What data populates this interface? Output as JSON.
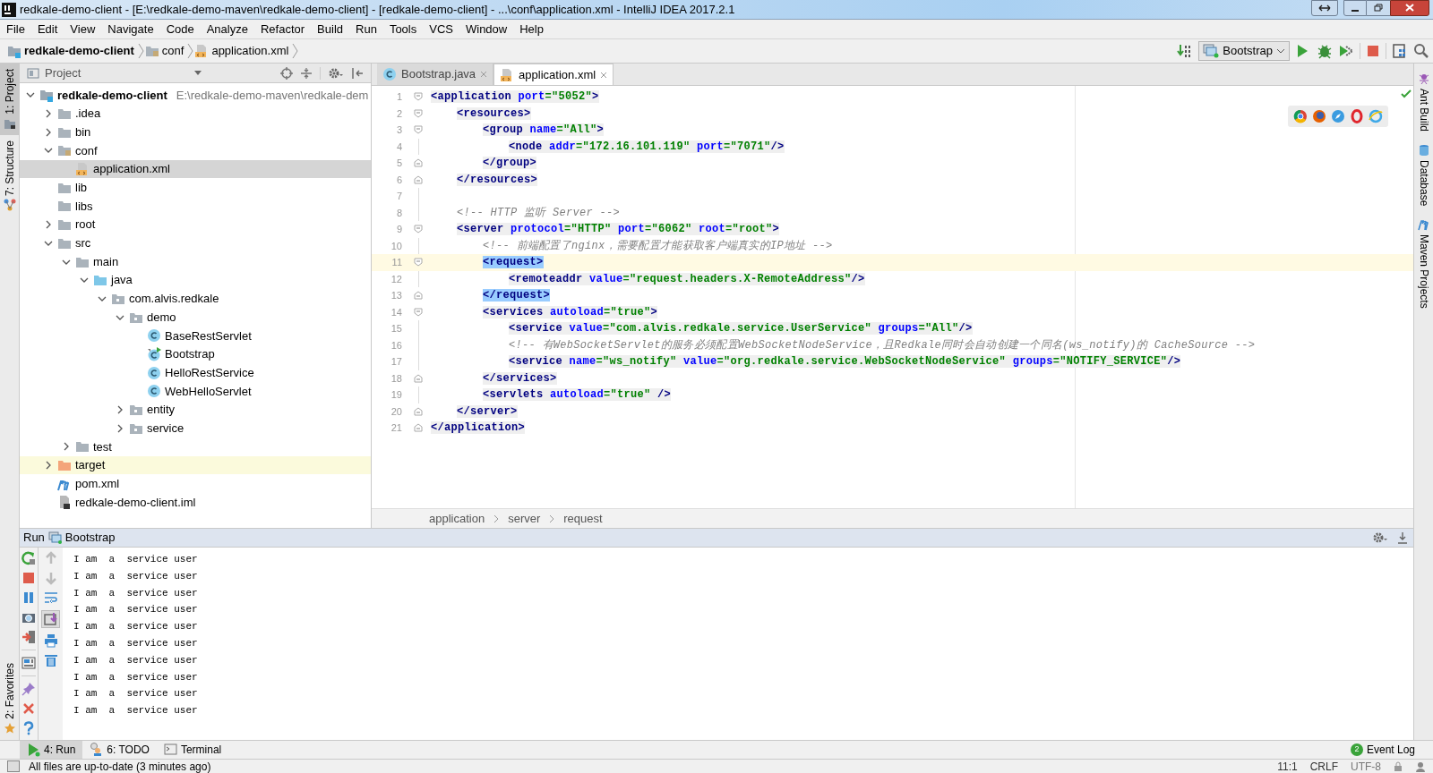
{
  "window": {
    "title": "redkale-demo-client - [E:\\redkale-demo-maven\\redkale-demo-client] - [redkale-demo-client] - ...\\conf\\application.xml - IntelliJ IDEA 2017.2.1"
  },
  "menu": [
    "File",
    "Edit",
    "View",
    "Navigate",
    "Code",
    "Analyze",
    "Refactor",
    "Build",
    "Run",
    "Tools",
    "VCS",
    "Window",
    "Help"
  ],
  "breadcrumb": [
    {
      "label": "redkale-demo-client",
      "kind": "module"
    },
    {
      "label": "conf",
      "kind": "config-folder"
    },
    {
      "label": "application.xml",
      "kind": "xml-file"
    }
  ],
  "run_config": "Bootstrap",
  "left_strip": [
    {
      "label": "1: Project",
      "selected": true
    },
    {
      "label": "7: Structure",
      "selected": false
    },
    {
      "label": "2: Favorites",
      "selected": false
    }
  ],
  "right_strip": [
    "Ant Build",
    "Database",
    "Maven Projects"
  ],
  "project_panel": {
    "title": "Project",
    "tree": [
      {
        "label": "redkale-demo-client",
        "kind": "module",
        "path": "E:\\redkale-demo-maven\\redkale-dem",
        "expanded": true,
        "selected": false,
        "children": [
          {
            "label": ".idea",
            "kind": "folder",
            "expanded": false,
            "selected": false
          },
          {
            "label": "bin",
            "kind": "folder",
            "expanded": false,
            "selected": false
          },
          {
            "label": "conf",
            "kind": "config-folder",
            "expanded": true,
            "selected": false,
            "children": [
              {
                "label": "application.xml",
                "kind": "xml-file",
                "selected": true
              }
            ]
          },
          {
            "label": "lib",
            "kind": "folder",
            "selected": false
          },
          {
            "label": "libs",
            "kind": "folder",
            "selected": false
          },
          {
            "label": "root",
            "kind": "folder",
            "expanded": false,
            "selected": false
          },
          {
            "label": "src",
            "kind": "folder",
            "expanded": true,
            "selected": false,
            "children": [
              {
                "label": "main",
                "kind": "folder",
                "expanded": true,
                "selected": false,
                "children": [
                  {
                    "label": "java",
                    "kind": "source-folder",
                    "expanded": true,
                    "selected": false,
                    "children": [
                      {
                        "label": "com.alvis.redkale",
                        "kind": "package",
                        "expanded": true,
                        "selected": false,
                        "children": [
                          {
                            "label": "demo",
                            "kind": "package",
                            "expanded": true,
                            "selected": false,
                            "children": [
                              {
                                "label": "BaseRestServlet",
                                "kind": "class",
                                "selected": false
                              },
                              {
                                "label": "Bootstrap",
                                "kind": "main-class",
                                "selected": false
                              },
                              {
                                "label": "HelloRestService",
                                "kind": "class",
                                "selected": false
                              },
                              {
                                "label": "WebHelloServlet",
                                "kind": "class",
                                "selected": false
                              }
                            ]
                          },
                          {
                            "label": "entity",
                            "kind": "package",
                            "expanded": false,
                            "selected": false
                          },
                          {
                            "label": "service",
                            "kind": "package",
                            "expanded": false,
                            "selected": false
                          }
                        ]
                      }
                    ]
                  }
                ]
              },
              {
                "label": "test",
                "kind": "folder",
                "expanded": false,
                "selected": false
              }
            ]
          },
          {
            "label": "target",
            "kind": "excluded-folder",
            "expanded": false,
            "selected": false
          },
          {
            "label": "pom.xml",
            "kind": "maven-file",
            "selected": false
          },
          {
            "label": "redkale-demo-client.iml",
            "kind": "iml-file",
            "selected": false
          }
        ]
      }
    ]
  },
  "editor": {
    "tabs": [
      {
        "label": "Bootstrap.java",
        "kind": "class",
        "selected": false
      },
      {
        "label": "application.xml",
        "kind": "xml-file",
        "selected": true
      }
    ],
    "lines": [
      {
        "number": "1",
        "kind": "opening",
        "current": false,
        "segments": [
          {
            "kind": "tag",
            "text": "<application"
          },
          {
            "kind": "attr",
            "text": " port"
          },
          {
            "kind": "value",
            "text": "=\"5052\""
          },
          {
            "kind": "tag",
            "text": ">"
          }
        ],
        "children": [
          {
            "number": "2",
            "kind": "opening",
            "current": false,
            "segments": [
              {
                "kind": "tag",
                "text": "<resources>"
              }
            ],
            "children": [
              {
                "number": "3",
                "kind": "opening",
                "current": false,
                "segments": [
                  {
                    "kind": "tag",
                    "text": "<group"
                  },
                  {
                    "kind": "attr",
                    "text": " name"
                  },
                  {
                    "kind": "value",
                    "text": "=\"All\""
                  },
                  {
                    "kind": "tag",
                    "text": ">"
                  }
                ],
                "children": [
                  {
                    "number": "4",
                    "kind": "plain",
                    "current": false,
                    "segments": [
                      {
                        "kind": "tag",
                        "text": "<node"
                      },
                      {
                        "kind": "attr",
                        "text": " addr"
                      },
                      {
                        "kind": "value",
                        "text": "=\"172.16.101.119\""
                      },
                      {
                        "kind": "attr",
                        "text": " port"
                      },
                      {
                        "kind": "value",
                        "text": "=\"7071\""
                      },
                      {
                        "kind": "tag",
                        "text": "/>"
                      }
                    ]
                  }
                ]
              },
              {
                "number": "5",
                "kind": "closing",
                "current": false,
                "segments": [
                  {
                    "kind": "tag",
                    "text": "</group>"
                  }
                ]
              }
            ]
          },
          {
            "number": "6",
            "kind": "closing",
            "current": false,
            "segments": [
              {
                "kind": "tag",
                "text": "</resources>"
              }
            ]
          },
          {
            "number": "7",
            "kind": "plain",
            "current": false
          },
          {
            "number": "8",
            "kind": "plain",
            "current": false,
            "segments": [
              {
                "kind": "comment",
                "text": "<!-- HTTP 监听 Server -->"
              }
            ]
          },
          {
            "number": "9",
            "kind": "opening",
            "current": false,
            "segments": [
              {
                "kind": "tag",
                "text": "<server"
              },
              {
                "kind": "attr",
                "text": " protocol"
              },
              {
                "kind": "value",
                "text": "=\"HTTP\""
              },
              {
                "kind": "attr",
                "text": " port"
              },
              {
                "kind": "value",
                "text": "=\"6062\""
              },
              {
                "kind": "attr",
                "text": " root"
              },
              {
                "kind": "value",
                "text": "=\"root\""
              },
              {
                "kind": "tag",
                "text": ">"
              }
            ],
            "children": [
              {
                "number": "10",
                "kind": "plain",
                "current": false,
                "segments": [
                  {
                    "kind": "comment",
                    "text": "<!-- 前端配置了nginx，需要配置才能获取客户端真实的IP地址 -->"
                  }
                ]
              },
              {
                "number": "11",
                "kind": "opening",
                "current": true,
                "segments": [
                  {
                    "kind": "tag",
                    "text": "<request>",
                    "matched": true
                  }
                ],
                "children": [
                  {
                    "number": "12",
                    "kind": "plain",
                    "current": false,
                    "segments": [
                      {
                        "kind": "tag",
                        "text": "<remoteaddr"
                      },
                      {
                        "kind": "attr",
                        "text": " value"
                      },
                      {
                        "kind": "value",
                        "text": "=\"request.headers.X-RemoteAddress\""
                      },
                      {
                        "kind": "tag",
                        "text": "/>"
                      }
                    ]
                  }
                ]
              },
              {
                "number": "13",
                "kind": "closing",
                "current": false,
                "segments": [
                  {
                    "kind": "tag",
                    "text": "</request>",
                    "matched": true
                  }
                ]
              },
              {
                "number": "14",
                "kind": "opening",
                "current": false,
                "segments": [
                  {
                    "kind": "tag",
                    "text": "<services"
                  },
                  {
                    "kind": "attr",
                    "text": " autoload"
                  },
                  {
                    "kind": "value",
                    "text": "=\"true\""
                  },
                  {
                    "kind": "tag",
                    "text": ">"
                  }
                ],
                "children": [
                  {
                    "number": "15",
                    "kind": "plain",
                    "current": false,
                    "segments": [
                      {
                        "kind": "tag",
                        "text": "<service"
                      },
                      {
                        "kind": "attr",
                        "text": " value"
                      },
                      {
                        "kind": "value",
                        "text": "=\"com.alvis.redkale.service.UserService\""
                      },
                      {
                        "kind": "attr",
                        "text": " groups"
                      },
                      {
                        "kind": "value",
                        "text": "=\"All\""
                      },
                      {
                        "kind": "tag",
                        "text": "/>"
                      }
                    ]
                  },
                  {
                    "number": "16",
                    "kind": "plain",
                    "current": false,
                    "segments": [
                      {
                        "kind": "comment",
                        "text": "<!-- 有WebSocketServlet的服务必须配置WebSocketNodeService，且Redkale同时会自动创建一个同名(ws_notify)的 CacheSource -->"
                      }
                    ]
                  },
                  {
                    "number": "17",
                    "kind": "plain",
                    "current": false,
                    "segments": [
                      {
                        "kind": "tag",
                        "text": "<service"
                      },
                      {
                        "kind": "attr",
                        "text": " name"
                      },
                      {
                        "kind": "value",
                        "text": "=\"ws_notify\""
                      },
                      {
                        "kind": "attr",
                        "text": " value"
                      },
                      {
                        "kind": "value",
                        "text": "=\"org.redkale.service.WebSocketNodeService\""
                      },
                      {
                        "kind": "attr",
                        "text": " groups"
                      },
                      {
                        "kind": "value",
                        "text": "=\"NOTIFY_SERVICE\""
                      },
                      {
                        "kind": "tag",
                        "text": "/>"
                      }
                    ]
                  }
                ]
              },
              {
                "number": "18",
                "kind": "closing",
                "current": false,
                "segments": [
                  {
                    "kind": "tag",
                    "text": "</services>"
                  }
                ]
              },
              {
                "number": "19",
                "kind": "plain",
                "current": false,
                "segments": [
                  {
                    "kind": "tag",
                    "text": "<servlets"
                  },
                  {
                    "kind": "attr",
                    "text": " autoload"
                  },
                  {
                    "kind": "value",
                    "text": "=\"true\""
                  },
                  {
                    "kind": "tag",
                    "text": " />"
                  }
                ]
              }
            ]
          },
          {
            "number": "20",
            "kind": "closing",
            "current": false,
            "segments": [
              {
                "kind": "tag",
                "text": "</server>"
              }
            ]
          }
        ]
      },
      {
        "number": "21",
        "kind": "closing",
        "current": false,
        "segments": [
          {
            "kind": "tag",
            "text": "</application>"
          }
        ]
      }
    ],
    "path": [
      "application",
      "server",
      "request"
    ]
  },
  "run_panel": {
    "title": "Run",
    "config": "Bootstrap",
    "output": [
      "I am  a  service user",
      "I am  a  service user",
      "I am  a  service user",
      "I am  a  service user",
      "I am  a  service user",
      "I am  a  service user",
      "I am  a  service user",
      "I am  a  service user",
      "I am  a  service user",
      "I am  a  service user"
    ]
  },
  "tool_tabs": [
    {
      "label": "4: Run",
      "kind": "run",
      "selected": true
    },
    {
      "label": "6: TODO",
      "kind": "todo",
      "selected": false
    },
    {
      "label": "Terminal",
      "kind": "terminal",
      "selected": false
    }
  ],
  "event_log": {
    "label": "Event Log",
    "count": "2"
  },
  "status_bar": {
    "message": "All files are up-to-date (3 minutes ago)",
    "position": "11:1",
    "line_separator": "CRLF",
    "encoding": "UTF-8"
  }
}
